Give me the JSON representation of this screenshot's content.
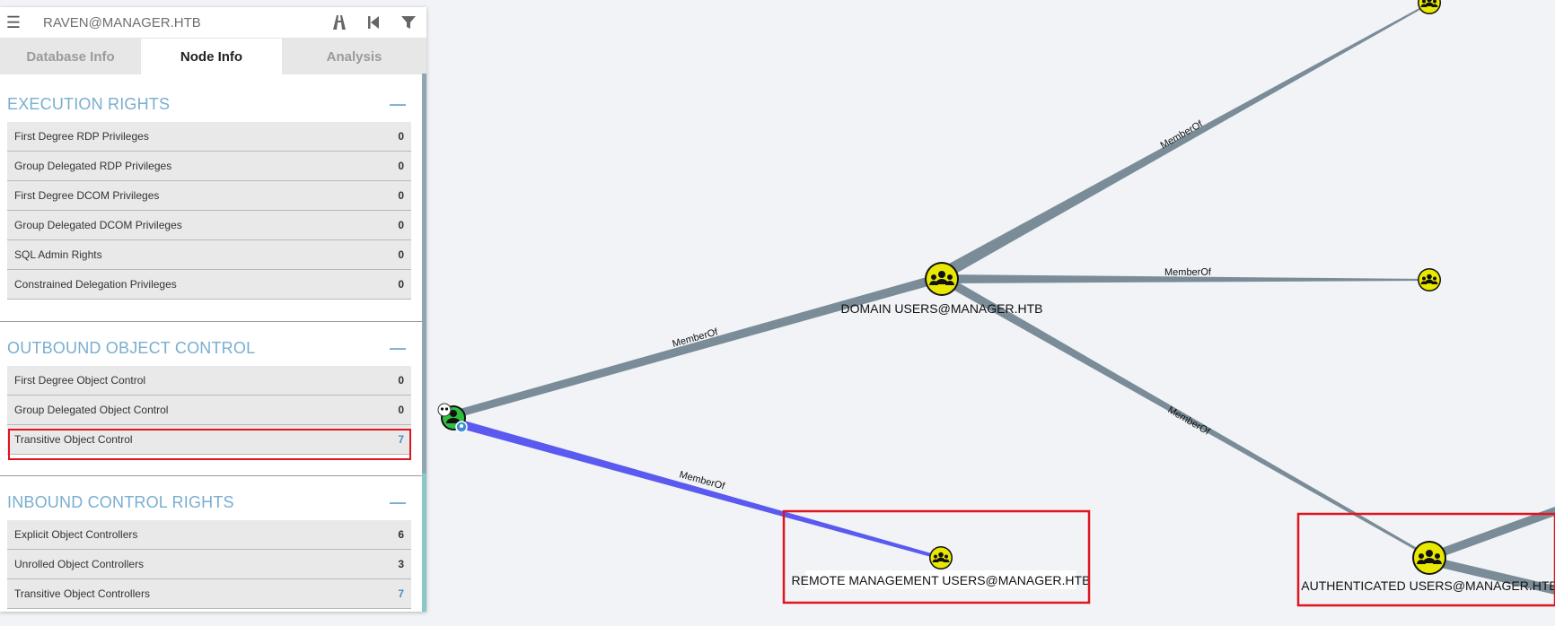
{
  "search": {
    "value": "RAVEN@MANAGER.HTB"
  },
  "toolbar_icons": [
    "pathfinding-icon",
    "back-icon",
    "filter-icon"
  ],
  "tabs": [
    {
      "label": "Database Info",
      "active": false
    },
    {
      "label": "Node Info",
      "active": true
    },
    {
      "label": "Analysis",
      "active": false
    }
  ],
  "sections": {
    "execution": {
      "title": "EXECUTION RIGHTS",
      "collapse": "—",
      "rows": [
        {
          "label": "First Degree RDP Privileges",
          "value": "0"
        },
        {
          "label": "Group Delegated RDP Privileges",
          "value": "0"
        },
        {
          "label": "First Degree DCOM Privileges",
          "value": "0"
        },
        {
          "label": "Group Delegated DCOM Privileges",
          "value": "0"
        },
        {
          "label": "SQL Admin Rights",
          "value": "0"
        },
        {
          "label": "Constrained Delegation Privileges",
          "value": "0"
        }
      ]
    },
    "outbound": {
      "title": "OUTBOUND OBJECT CONTROL",
      "collapse": "—",
      "rows": [
        {
          "label": "First Degree Object Control",
          "value": "0"
        },
        {
          "label": "Group Delegated Object Control",
          "value": "0"
        },
        {
          "label": "Transitive Object Control",
          "value": "7"
        }
      ]
    },
    "inbound": {
      "title": "INBOUND CONTROL RIGHTS",
      "collapse": "—",
      "rows": [
        {
          "label": "Explicit Object Controllers",
          "value": "6"
        },
        {
          "label": "Unrolled Object Controllers",
          "value": "3"
        },
        {
          "label": "Transitive Object Controllers",
          "value": "7"
        }
      ]
    }
  },
  "graph": {
    "nodes": {
      "domain_users": "DOMAIN USERS@MANAGER.HTB",
      "remote_mgmt": "REMOTE MANAGEMENT USERS@MANAGER.HTB",
      "auth_users": "AUTHENTICATED USERS@MANAGER.HTB"
    },
    "edge_label": "MemberOf",
    "colors": {
      "edge": "#7a8c98",
      "highlight_edge": "#5a5af0",
      "group_node": "#e8e800",
      "highlight_box": "#e0141e"
    }
  }
}
